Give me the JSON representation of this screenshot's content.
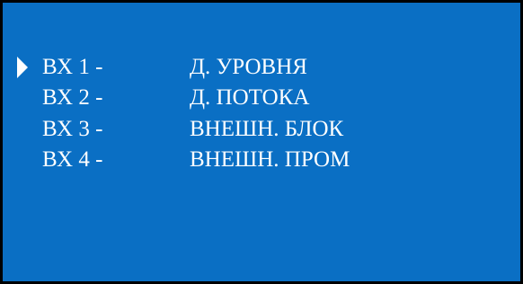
{
  "menu": {
    "items": [
      {
        "label": "ВХ 1 -",
        "value": "Д. УРОВНЯ",
        "selected": true
      },
      {
        "label": "ВХ 2 -",
        "value": "Д. ПОТОКА",
        "selected": false
      },
      {
        "label": "ВХ 3 -",
        "value": "ВНЕШН. БЛОК",
        "selected": false
      },
      {
        "label": "ВХ 4 -",
        "value": "ВНЕШН. ПРОМ",
        "selected": false
      }
    ]
  },
  "colors": {
    "background": "#0a6fc4",
    "text": "#ffffff",
    "border": "#000000"
  },
  "icons": {
    "cursor": "right-triangle-cursor-icon"
  }
}
